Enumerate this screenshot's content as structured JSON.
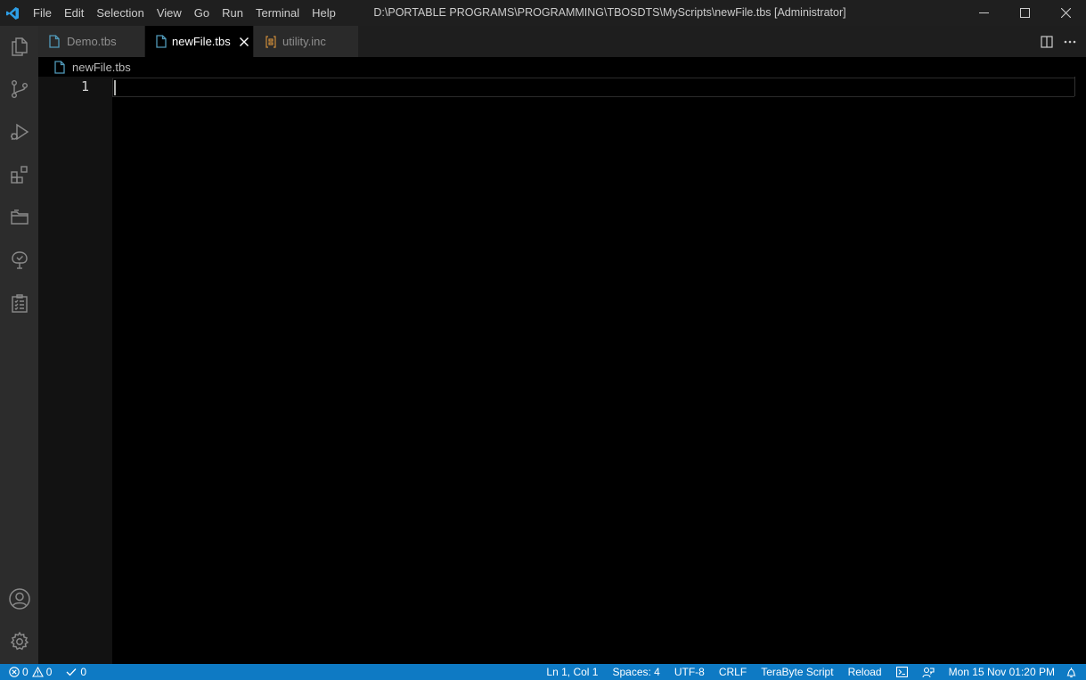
{
  "window": {
    "title": "D:\\PORTABLE PROGRAMS\\PROGRAMMING\\TBOSDTS\\MyScripts\\newFile.tbs [Administrator]"
  },
  "menu": [
    "File",
    "Edit",
    "Selection",
    "View",
    "Go",
    "Run",
    "Terminal",
    "Help"
  ],
  "activity_bar": {
    "top": [
      "explorer-icon",
      "source-control-icon",
      "run-debug-icon",
      "extensions-icon",
      "folder-icon",
      "tree-icon",
      "clipboard-checklist-icon"
    ],
    "bottom": [
      "account-icon",
      "settings-gear-icon"
    ]
  },
  "tabs": [
    {
      "label": "Demo.tbs",
      "icon": "file-icon",
      "active": false
    },
    {
      "label": "newFile.tbs",
      "icon": "file-icon",
      "active": true
    },
    {
      "label": "utility.inc",
      "icon": "json-file-icon",
      "active": false
    }
  ],
  "breadcrumb": {
    "label": "newFile.tbs"
  },
  "editor": {
    "line_numbers": [
      "1"
    ]
  },
  "status_bar": {
    "errors": "0",
    "warnings": "0",
    "checks": "0",
    "position": "Ln 1, Col 1",
    "spaces": "Spaces: 4",
    "encoding": "UTF-8",
    "eol": "CRLF",
    "language": "TeraByte Script",
    "reload": "Reload",
    "datetime": "Mon 15 Nov 01:20 PM"
  },
  "colors": {
    "accent": "#0e7ac4",
    "activity_bar": "#2c2c2c",
    "title_bar": "#1f1f1f",
    "editor_bg": "#000000",
    "file_icon": "#519aba",
    "json_icon": "#cb8b3a"
  }
}
